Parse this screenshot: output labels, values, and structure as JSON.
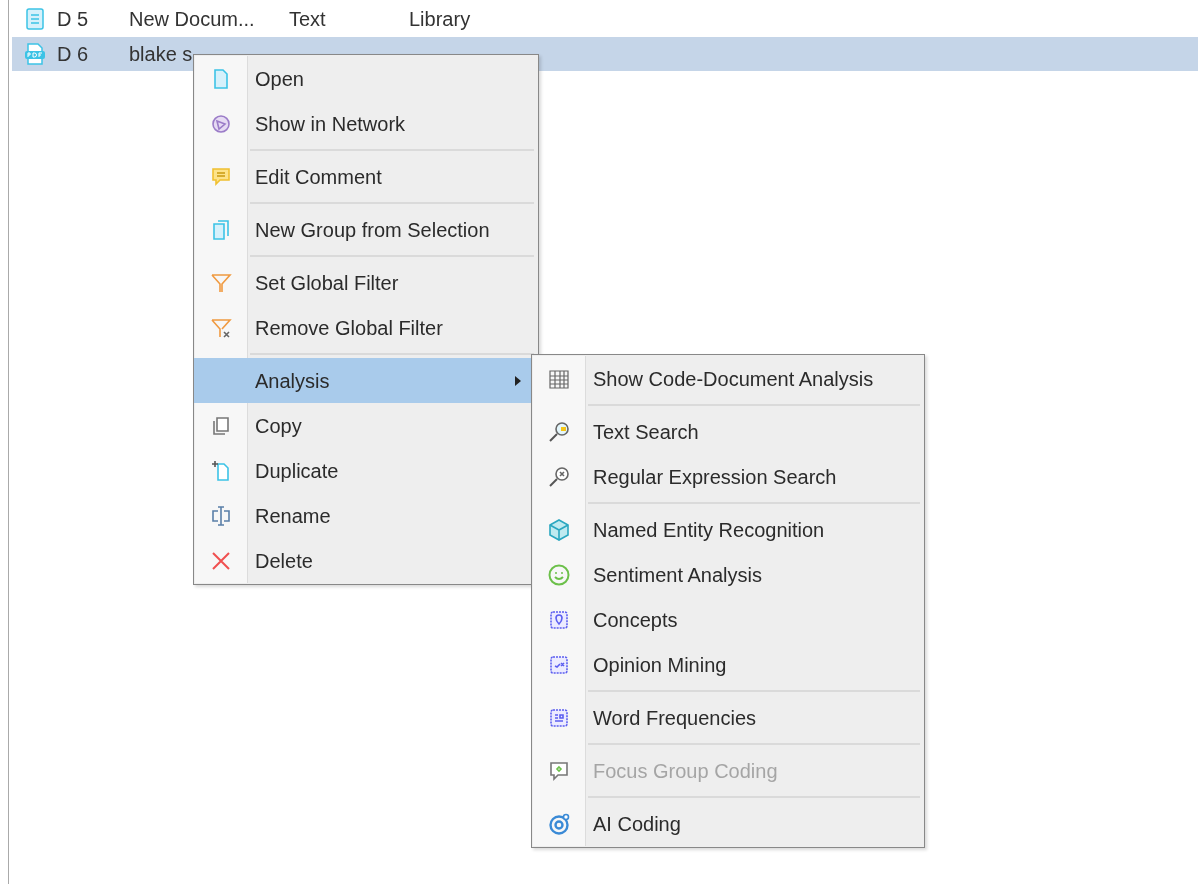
{
  "table": {
    "rows": [
      {
        "kind": "text",
        "id": "D 5",
        "name": "New Docum...",
        "type": "Text",
        "location": "Library",
        "selected": false
      },
      {
        "kind": "pdf",
        "id": "D 6",
        "name": "blake s",
        "selected": true
      }
    ]
  },
  "context_menu": {
    "groups": [
      [
        {
          "label": "Open",
          "selected": false
        },
        {
          "label": "Show in Network",
          "selected": false
        }
      ],
      [
        {
          "label": "Edit Comment",
          "selected": false
        }
      ],
      [
        {
          "label": "New Group from Selection",
          "selected": false
        }
      ],
      [
        {
          "label": "Set Global Filter",
          "selected": false
        },
        {
          "label": "Remove Global Filter",
          "selected": false
        }
      ],
      [
        {
          "label": "Analysis",
          "selected": true,
          "submenu": {
            "groups": [
              [
                {
                  "label": "Show Code-Document Analysis",
                  "disabled": false
                }
              ],
              [
                {
                  "label": "Text Search",
                  "disabled": false
                },
                {
                  "label": "Regular Expression Search",
                  "disabled": false
                }
              ],
              [
                {
                  "label": "Named Entity Recognition",
                  "disabled": false
                },
                {
                  "label": "Sentiment Analysis",
                  "disabled": false
                },
                {
                  "label": "Concepts",
                  "disabled": false
                },
                {
                  "label": "Opinion Mining",
                  "disabled": false
                }
              ],
              [
                {
                  "label": "Word Frequencies",
                  "disabled": false
                }
              ],
              [
                {
                  "label": "Focus Group Coding",
                  "disabled": true
                }
              ],
              [
                {
                  "label": "AI Coding",
                  "disabled": false
                }
              ]
            ]
          }
        },
        {
          "label": "Copy",
          "selected": false
        },
        {
          "label": "Duplicate",
          "selected": false
        },
        {
          "label": "Rename",
          "selected": false
        },
        {
          "label": "Delete",
          "selected": false
        }
      ]
    ]
  }
}
